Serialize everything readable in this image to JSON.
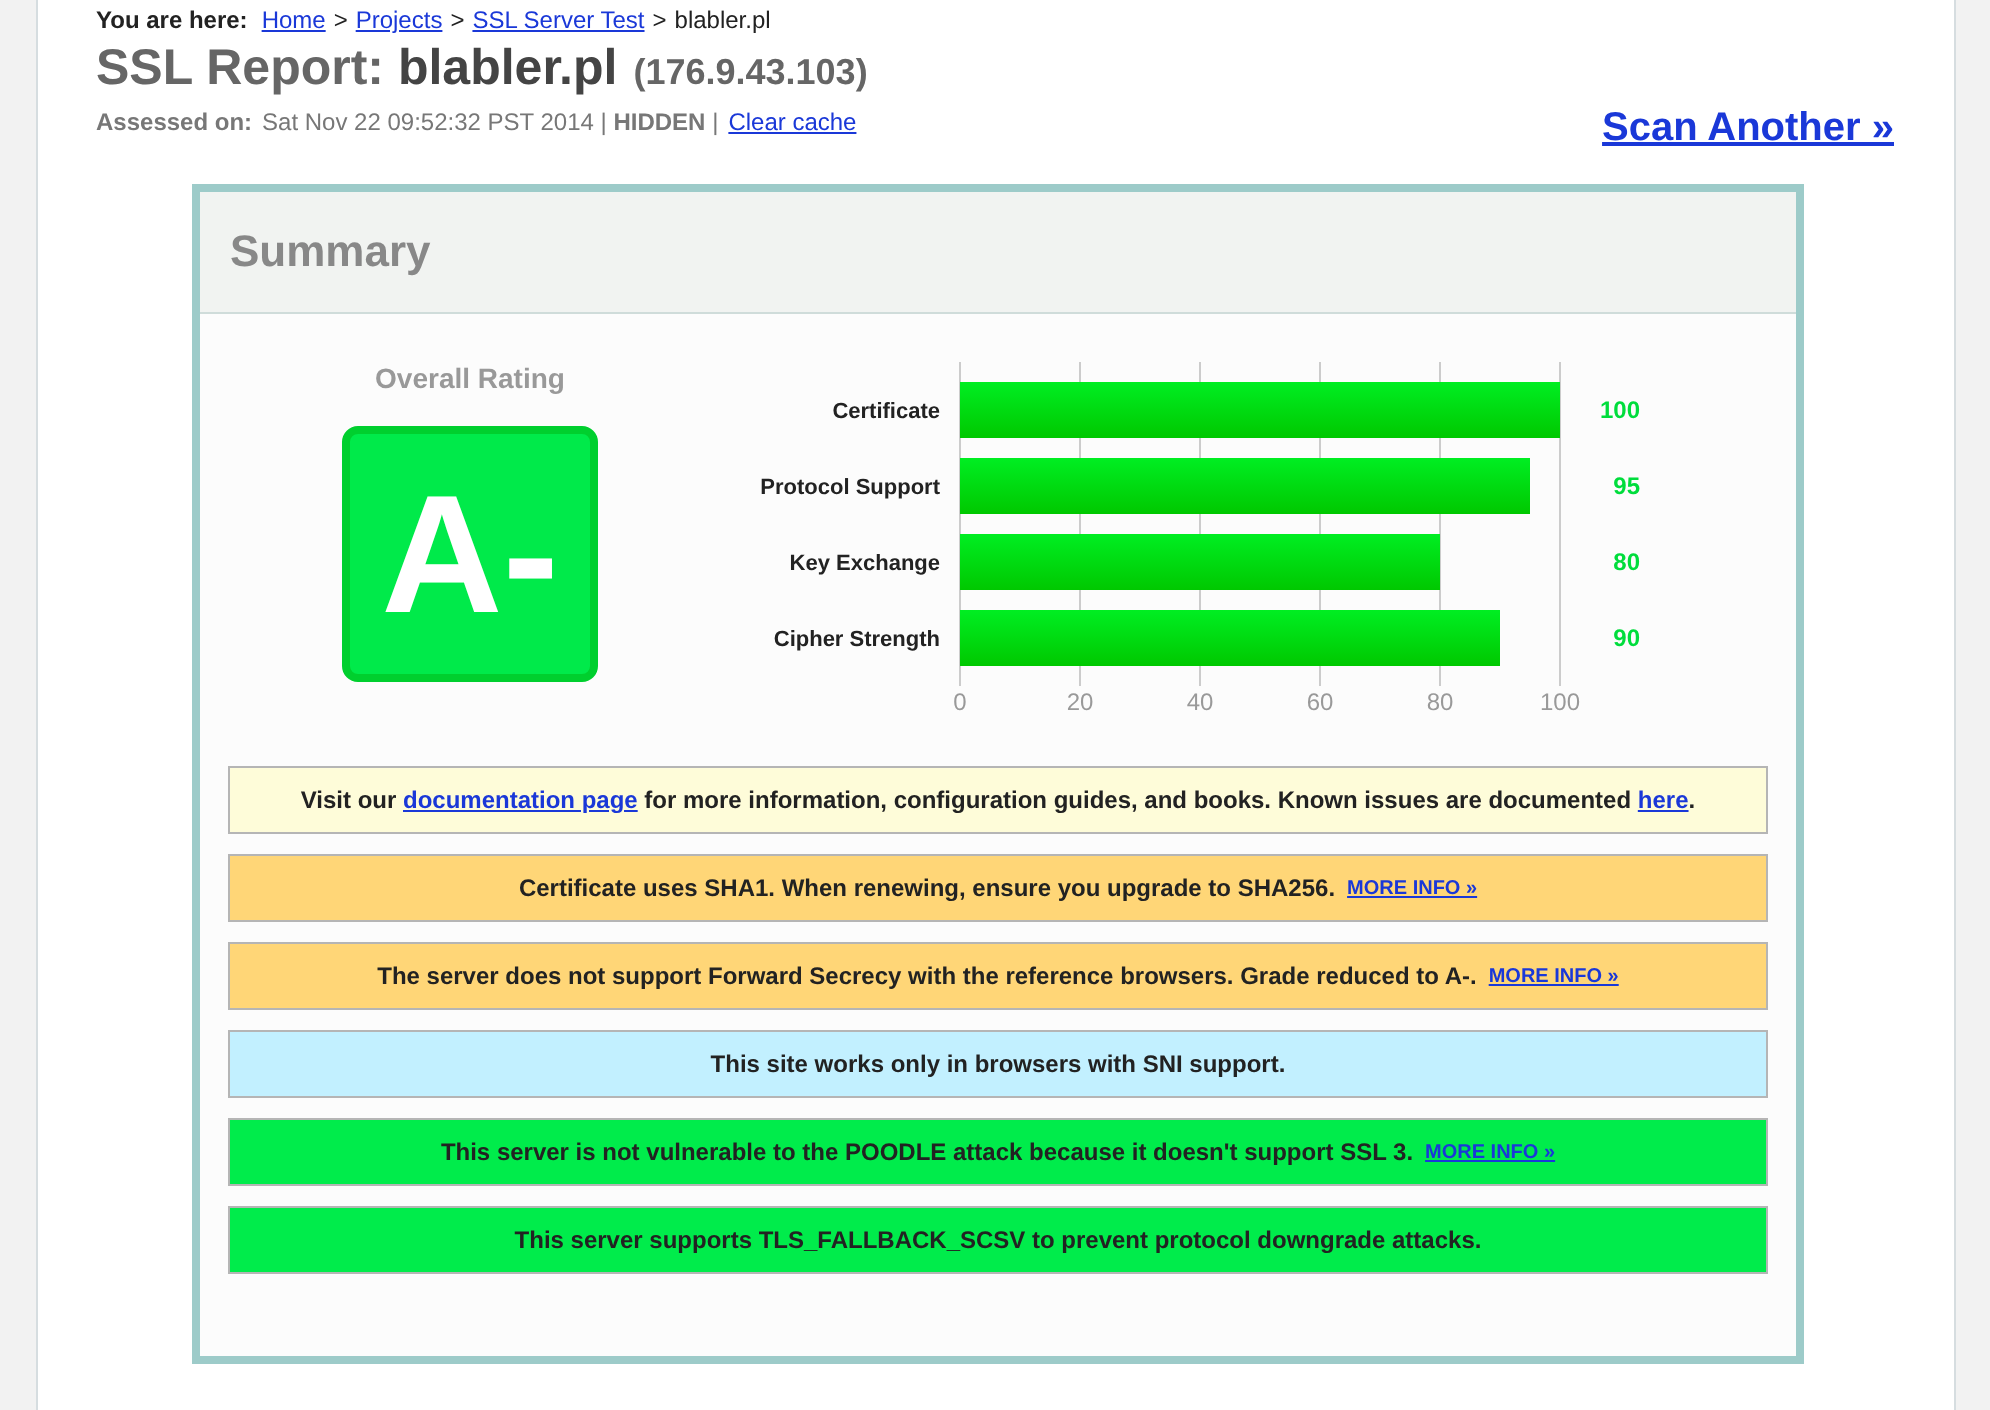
{
  "breadcrumb": {
    "label": "You are here:",
    "separator": ">",
    "items": [
      {
        "text": "Home",
        "link": true
      },
      {
        "text": "Projects",
        "link": true
      },
      {
        "text": "SSL Server Test",
        "link": true
      },
      {
        "text": "blabler.pl",
        "link": false
      }
    ]
  },
  "report": {
    "title": "SSL Report:",
    "host": "blabler.pl",
    "ip": "(176.9.43.103)",
    "assessed_label": "Assessed on:",
    "assessed_value": "Sat Nov 22 09:52:32 PST 2014 | **HIDDEN** |",
    "clear_cache": "Clear cache",
    "scan_another": "Scan Another »"
  },
  "summary": {
    "title": "Summary",
    "rating_label": "Overall Rating",
    "grade": "A-",
    "chart_data": {
      "type": "bar",
      "orientation": "horizontal",
      "categories": [
        "Certificate",
        "Protocol Support",
        "Key Exchange",
        "Cipher Strength"
      ],
      "values": [
        100,
        95,
        80,
        90
      ],
      "xlim": [
        0,
        100
      ],
      "xticks": [
        0,
        20,
        40,
        60,
        80,
        100
      ],
      "grid": true,
      "data_labels": true
    },
    "notices": [
      {
        "kind": "info",
        "parts": [
          {
            "kind": "text",
            "text": "Visit our "
          },
          {
            "kind": "link",
            "text": "documentation page"
          },
          {
            "kind": "text",
            "text": " for more information, configuration guides, and books. Known issues are documented "
          },
          {
            "kind": "link",
            "text": "here"
          },
          {
            "kind": "text",
            "text": "."
          }
        ]
      },
      {
        "kind": "warning",
        "parts": [
          {
            "kind": "text",
            "text": "Certificate uses SHA1. When renewing, ensure you upgrade to SHA256."
          },
          {
            "kind": "more",
            "text": "MORE INFO »"
          }
        ]
      },
      {
        "kind": "warning",
        "parts": [
          {
            "kind": "text",
            "text": "The server does not support Forward Secrecy with the reference browsers. Grade reduced to A-."
          },
          {
            "kind": "more",
            "text": "MORE INFO »"
          }
        ]
      },
      {
        "kind": "note",
        "parts": [
          {
            "kind": "text",
            "text": "This site works only in browsers with SNI support."
          }
        ]
      },
      {
        "kind": "good",
        "parts": [
          {
            "kind": "text",
            "text": "This server is not vulnerable to the POODLE attack because it doesn't support SSL 3."
          },
          {
            "kind": "more",
            "text": "MORE INFO »"
          }
        ]
      },
      {
        "kind": "good",
        "parts": [
          {
            "kind": "text",
            "text": "This server supports TLS_FALLBACK_SCSV to prevent protocol downgrade attacks."
          }
        ]
      }
    ]
  }
}
